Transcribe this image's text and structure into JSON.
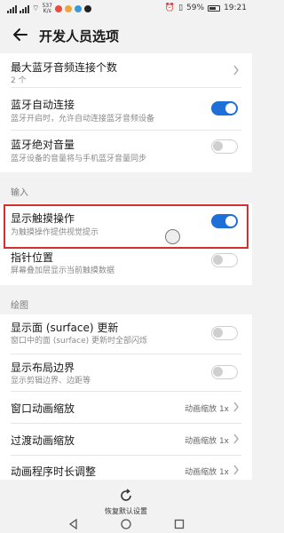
{
  "status_bar": {
    "speed_value": "537",
    "speed_unit": "K/s",
    "battery": "59%",
    "time": "19:21"
  },
  "header": {
    "title": "开发人员选项"
  },
  "bluetooth": {
    "max_devices": {
      "title": "最大蓝牙音频连接个数",
      "value": "2 个"
    },
    "auto_connect": {
      "title": "蓝牙自动连接",
      "subtitle": "蓝牙开启时，允许自动连接蓝牙音频设备",
      "enabled": true
    },
    "absolute_volume": {
      "title": "蓝牙绝对音量",
      "subtitle": "蓝牙设备的音量将与手机蓝牙音量同步",
      "enabled": false
    }
  },
  "input": {
    "section_label": "输入",
    "show_taps": {
      "title": "显示触摸操作",
      "subtitle": "为触摸操作提供视觉提示",
      "enabled": true
    },
    "pointer_location": {
      "title": "指针位置",
      "subtitle": "屏幕叠加层显示当前触摸数据",
      "enabled": false
    }
  },
  "drawing": {
    "section_label": "绘图",
    "show_surface_updates": {
      "title": "显示面 (surface) 更新",
      "subtitle": "窗口中的面 (surface) 更新时全部闪烁",
      "enabled": false
    },
    "show_layout_bounds": {
      "title": "显示布局边界",
      "subtitle": "显示剪辑边界、边距等",
      "enabled": false
    },
    "window_animation_scale": {
      "title": "窗口动画缩放",
      "value": "动画缩放 1x"
    },
    "transition_animation_scale": {
      "title": "过渡动画缩放",
      "value": "动画缩放 1x"
    },
    "animator_duration_scale": {
      "title": "动画程序时长调整",
      "value": "动画缩放 1x"
    }
  },
  "bottom": {
    "restore_label": "恢复默认设置"
  },
  "colors": {
    "accent": "#1f6fd8",
    "highlight": "#d32f2f"
  }
}
